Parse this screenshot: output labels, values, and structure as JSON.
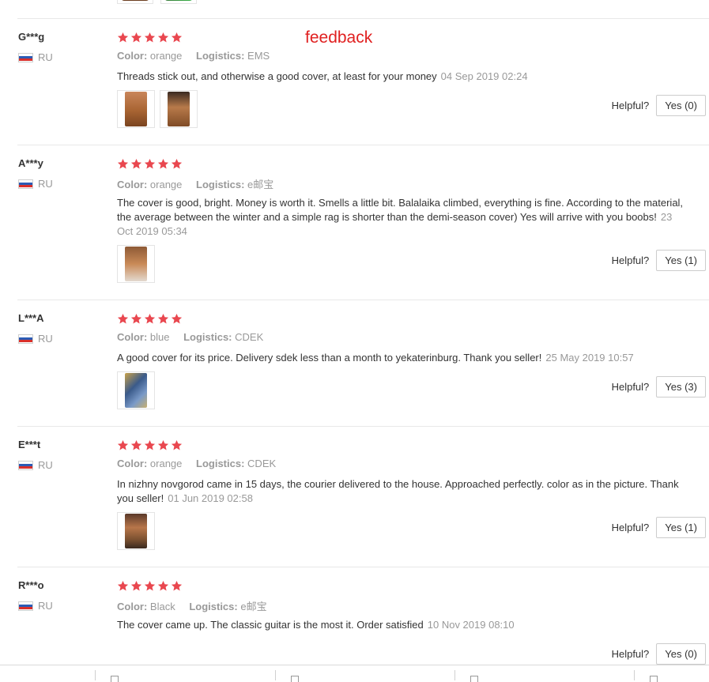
{
  "annotation_label": "feedback",
  "meta_labels": {
    "color": "Color:",
    "logistics": "Logistics:"
  },
  "helpful_label": "Helpful?",
  "colors": {
    "star": "#e9474f",
    "annotation": "#e02020",
    "flag_white": "#ffffff",
    "flag_blue": "#2b5bb5",
    "flag_red": "#d9302b"
  },
  "icons": {
    "star": "star-icon",
    "flag": "russia-flag-icon",
    "doc": "document-icon"
  },
  "reviews": [
    {
      "user": "G***g",
      "country": "RU",
      "rating": 5,
      "color": "orange",
      "logistics": "EMS",
      "text": "Threads stick out, and otherwise a good cover, at least for your money",
      "date": "04 Sep 2019 02:24",
      "photos": 2,
      "helpful_button": "Yes (0)"
    },
    {
      "user": "A***y",
      "country": "RU",
      "rating": 5,
      "color": "orange",
      "logistics": "e邮宝",
      "text": "The cover is good, bright. Money is worth it. Smells a little bit. Balalaika climbed, everything is fine. According to the material, the average between the winter and a simple rag is shorter than the demi-season cover) Yes will arrive with you boobs!",
      "date": "23 Oct 2019 05:34",
      "photos": 1,
      "helpful_button": "Yes (1)"
    },
    {
      "user": "L***A",
      "country": "RU",
      "rating": 5,
      "color": "blue",
      "logistics": "CDEK",
      "text": "A good cover for its price. Delivery sdek less than a month to yekaterinburg. Thank you seller!",
      "date": "25 May 2019 10:57",
      "photos": 1,
      "helpful_button": "Yes (3)"
    },
    {
      "user": "E***t",
      "country": "RU",
      "rating": 5,
      "color": "orange",
      "logistics": "CDEK",
      "text": "In nizhny novgorod came in 15 days, the courier delivered to the house. Approached perfectly. color as in the picture. Thank you seller!",
      "date": "01 Jun 2019 02:58",
      "photos": 1,
      "helpful_button": "Yes (1)"
    },
    {
      "user": "R***o",
      "country": "RU",
      "rating": 5,
      "color": "Black",
      "logistics": "e邮宝",
      "text": "The cover came up. The classic guitar is the most it. Order satisfied",
      "date": "10 Nov 2019 08:10",
      "photos": 0,
      "helpful_button": "Yes (0)"
    }
  ]
}
